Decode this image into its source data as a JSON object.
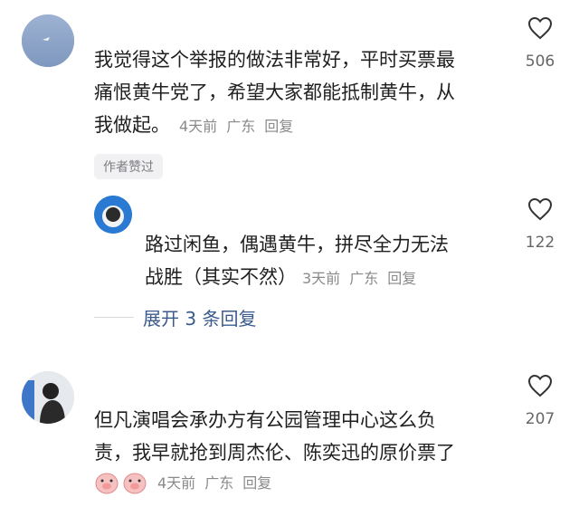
{
  "comments": [
    {
      "text_lines": [
        "我觉得这个举报的做法非常好，平时买票最",
        "痛恨黄牛党了，希望大家都能抵制黄牛，从",
        "我做起。"
      ],
      "time": "4天前",
      "location": "广东",
      "reply_label": "回复",
      "likes": "506",
      "author_badge": "作者赞过"
    },
    {
      "text_lines": [
        "路过闲鱼，偶遇黄牛，拼尽全力无法",
        "战胜（其实不然）"
      ],
      "time": "3天前",
      "location": "广东",
      "reply_label": "回复",
      "likes": "122"
    },
    {
      "text_lines": [
        "但凡演唱会承办方有公园管理中心这么负",
        "责，我早就抢到周杰伦、陈奕迅的原价票了"
      ],
      "time": "4天前",
      "location": "广东",
      "reply_label": "回复",
      "likes": "207"
    }
  ],
  "expand_replies_label": "展开 3 条回复",
  "icons": [
    "heart-icon",
    "pig-sticker-icon"
  ],
  "colors": {
    "link": "#3b5b8c",
    "meta": "#8a8a8a"
  }
}
